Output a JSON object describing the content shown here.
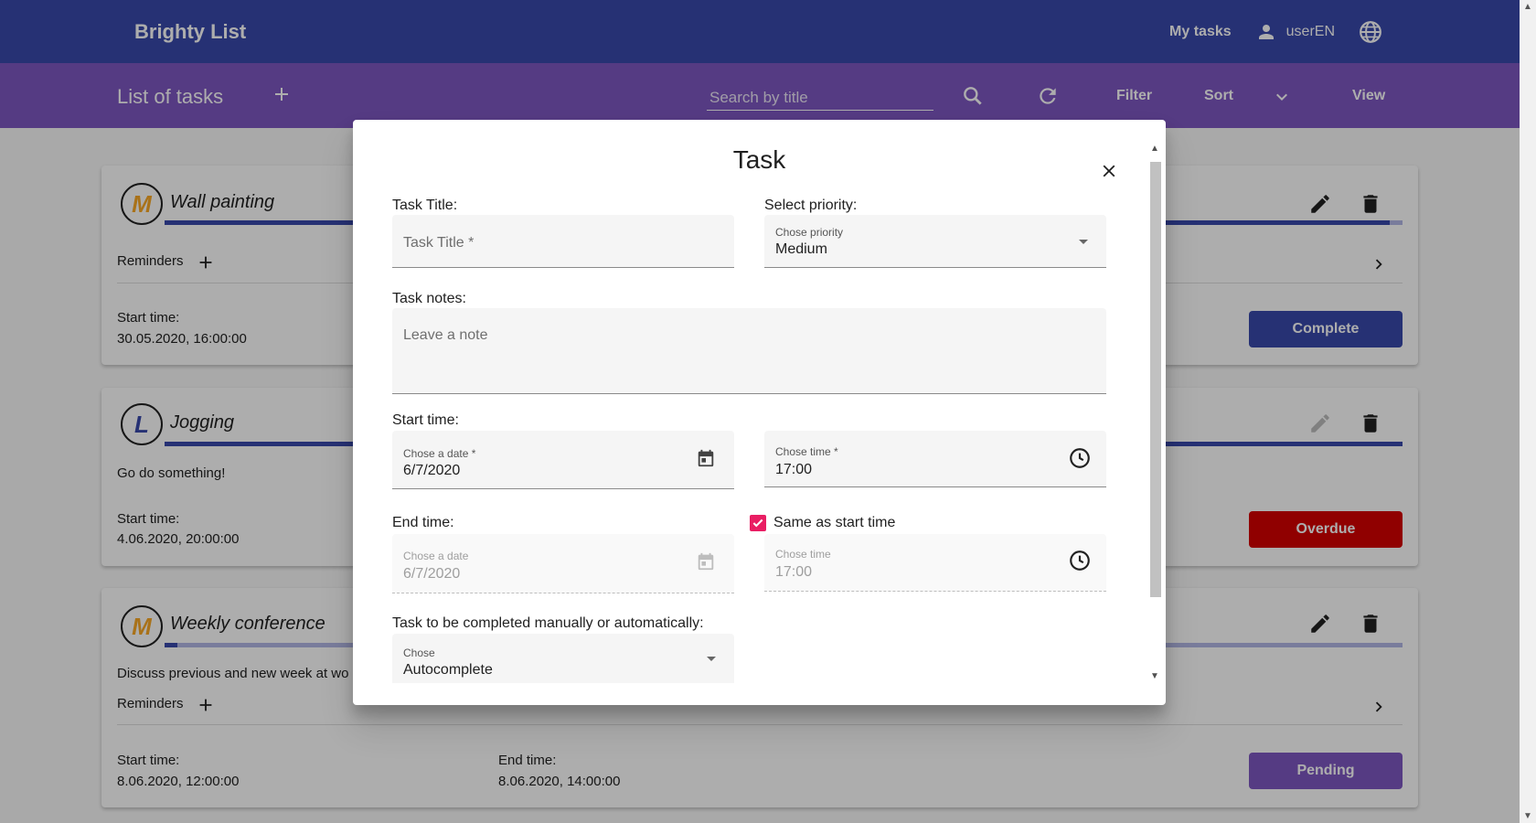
{
  "app": {
    "brand": "Brighty List",
    "my_tasks": "My tasks",
    "username": "userEN"
  },
  "toolbar": {
    "title": "List of tasks",
    "search_placeholder": "Search by title",
    "filter": "Filter",
    "sort": "Sort",
    "view": "View"
  },
  "tasks": [
    {
      "priority": "M",
      "name": "Wall painting",
      "reminders_label": "Reminders",
      "start_label": "Start time:",
      "start_value": "30.05.2020, 16:00:00",
      "action": "Complete",
      "action_color": "#3949ab",
      "progress": 0.99
    },
    {
      "priority": "L",
      "name": "Jogging",
      "note": "Go do something!",
      "start_label": "Start time:",
      "start_value": "4.06.2020, 20:00:00",
      "action": "Overdue",
      "action_color": "#d50000",
      "progress": 1.0
    },
    {
      "priority": "M",
      "name": "Weekly conference",
      "note": "Discuss previous and new week at wo",
      "reminders_label": "Reminders",
      "start_label": "Start time:",
      "start_value": "8.06.2020, 12:00:00",
      "end_label": "End time:",
      "end_value": "8.06.2020, 14:00:00",
      "action": "Pending",
      "action_color": "#7e57c2",
      "progress": 0.01
    }
  ],
  "dialog": {
    "title": "Task",
    "task_title_label": "Task Title:",
    "task_title_placeholder": "Task Title *",
    "priority_label": "Select priority:",
    "priority_float": "Chose priority",
    "priority_value": "Medium",
    "notes_label": "Task notes:",
    "notes_placeholder": "Leave a note",
    "start_label": "Start time:",
    "start_date_float": "Chose a date *",
    "start_date_value": "6/7/2020",
    "start_time_float": "Chose time *",
    "start_time_value": "17:00",
    "end_label": "End time:",
    "same_as_start_label": "Same as start time",
    "same_as_start_checked": true,
    "end_date_float": "Chose a date",
    "end_date_value": "6/7/2020",
    "end_time_float": "Chose time",
    "end_time_value": "17:00",
    "completion_label": "Task to be completed manually or automatically:",
    "completion_float": "Chose",
    "completion_value": "Autocomplete"
  },
  "colors": {
    "primary": "#3949ab",
    "accent": "#7e57c2",
    "warn": "#d50000",
    "checkbox": "#e91e63",
    "priority_medium": "#f9a825"
  }
}
